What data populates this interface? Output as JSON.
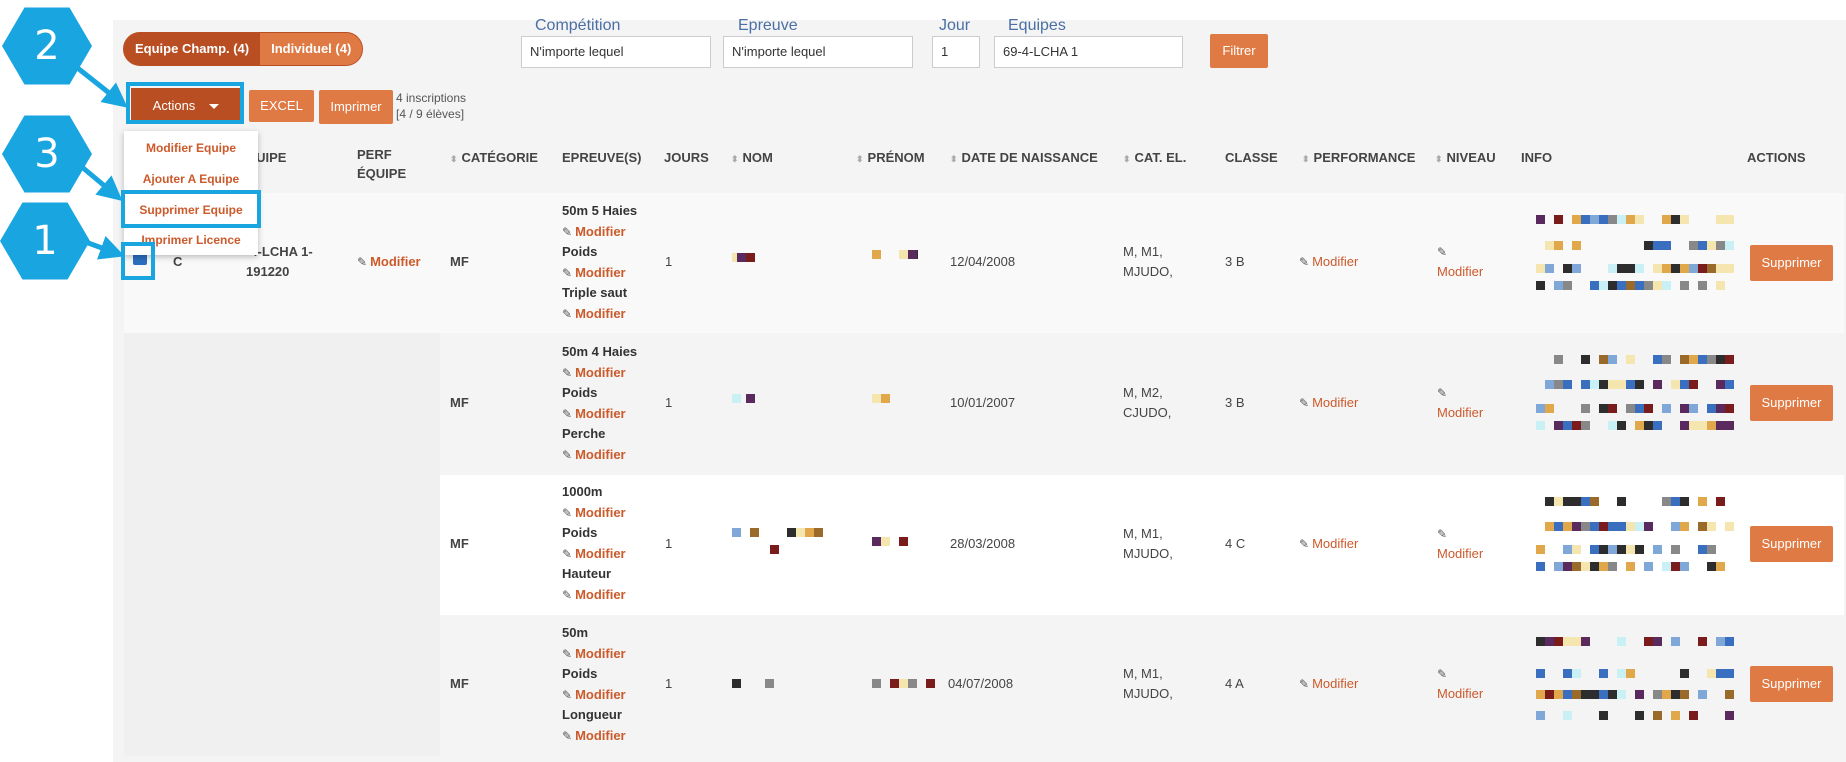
{
  "toggle": {
    "team_label": "Equipe Champ. (4)",
    "individual_label": "Individuel (4)"
  },
  "filters": {
    "competition_label": "Compétition",
    "competition_value": "N'importe lequel",
    "epreuve_label": "Epreuve",
    "epreuve_value": "N'importe lequel",
    "jour_label": "Jour",
    "jour_value": "1",
    "equipes_label": "Equipes",
    "equipes_value": "69-4-LCHA 1",
    "filter_button": "Filtrer"
  },
  "toolbar": {
    "actions_label": "Actions",
    "excel_label": "EXCEL",
    "print_label": "Imprimer",
    "count_line1": "4 inscriptions",
    "count_line2": "[4 / 9 élèves]"
  },
  "dropdown": {
    "items": [
      "Modifier Equipe",
      "Ajouter A Equipe",
      "Supprimer Equipe",
      "Imprimer Licence"
    ]
  },
  "annotations": [
    "1",
    "2",
    "3"
  ],
  "annotation_color": "#18a5e0",
  "accent_color": "#e07a45",
  "table": {
    "headers": {
      "equipe": "QUIPE",
      "perf_equipe_1": "PERF",
      "perf_equipe_2": "ÉQUIPE",
      "categorie": "CATÉGORIE",
      "epreuves": "EPREUVE(S)",
      "jours": "JOURS",
      "nom": "NOM",
      "prenom": "PRÉNOM",
      "date": "DATE DE NAISSANCE",
      "cat_el": "CAT. EL.",
      "classe": "CLASSE",
      "performance": "PERFORMANCE",
      "niveau": "NIVEAU",
      "info": "INFO",
      "actions": "ACTIONS"
    },
    "team": {
      "letter": "C",
      "code_line1": "-4-LCHA 1-",
      "code_line2": "191220",
      "perf_label": "Modifier"
    },
    "modify_label": "Modifier",
    "delete_label": "Supprimer",
    "rows": [
      {
        "categorie": "MF",
        "ev1": "50m 5 Haies",
        "ev2": "Poids",
        "ev3": "Triple saut",
        "jours": "1",
        "date": "12/04/2008",
        "cat1": "M, M1,",
        "cat2": "MJUDO,",
        "classe": "3 B"
      },
      {
        "categorie": "MF",
        "ev1": "50m 4 Haies",
        "ev2": "Poids",
        "ev3": "Perche",
        "jours": "1",
        "date": "10/01/2007",
        "cat1": "M, M2,",
        "cat2": "CJUDO,",
        "classe": "3 B"
      },
      {
        "categorie": "MF",
        "ev1": "1000m",
        "ev2": "Poids",
        "ev3": "Hauteur",
        "jours": "1",
        "date": "28/03/2008",
        "cat1": "M, M1,",
        "cat2": "MJUDO,",
        "classe": "4 C"
      },
      {
        "categorie": "MF",
        "ev1": "50m",
        "ev2": "Poids",
        "ev3": "Longueur",
        "jours": "1",
        "date": "04/07/2008",
        "cat1": "M, M1,",
        "cat2": "MJUDO,",
        "classe": "4 A"
      }
    ]
  }
}
